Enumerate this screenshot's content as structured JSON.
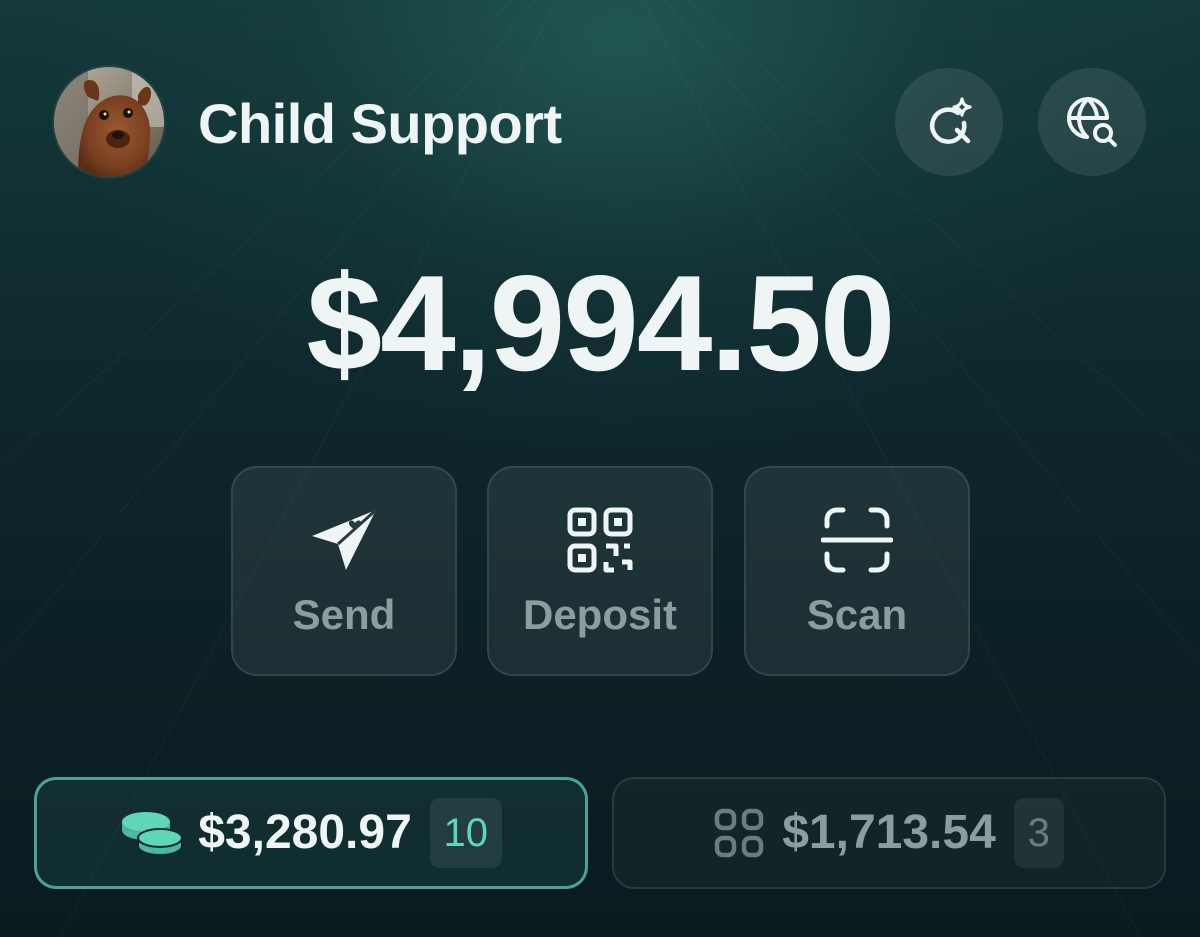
{
  "header": {
    "account_name": "Child Support",
    "avatar_icon": "dog-avatar-photo",
    "actions": [
      {
        "icon": "search-sparkle-icon"
      },
      {
        "icon": "globe-search-icon"
      }
    ]
  },
  "balance": {
    "total": "$4,994.50"
  },
  "actions": {
    "send_label": "Send",
    "deposit_label": "Deposit",
    "scan_label": "Scan"
  },
  "holdings": {
    "tokens": {
      "icon": "coins-icon",
      "amount": "$3,280.97",
      "count": "10",
      "active": true
    },
    "collectibles": {
      "icon": "grid-icon",
      "amount": "$1,713.54",
      "count": "3",
      "active": false
    }
  },
  "colors": {
    "accent": "#5fd6b8",
    "accent_border": "#62c8b6",
    "text_primary": "#eef5f4",
    "text_muted": "#8d9c9d",
    "background_dark": "#0c2126",
    "background_glow": "#2c6e68"
  }
}
